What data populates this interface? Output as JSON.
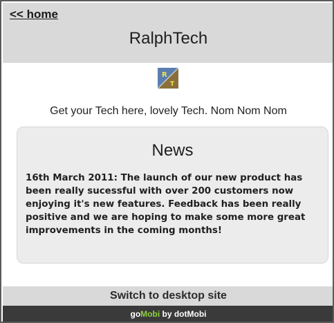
{
  "header": {
    "home_link": "<< home",
    "title": "RalphTech"
  },
  "logo": {
    "letters": [
      "R",
      "T"
    ],
    "icon": "ralphtech-logo-icon"
  },
  "tagline": "Get your Tech here, lovely Tech. Nom Nom Nom",
  "news": {
    "title": "News",
    "body": "16th March 2011: The launch of our new product has been really sucessful with over 200 customers now enjoying it's new features. Feedback has been really positive and we are hoping to make some more great improvements in the coming months!"
  },
  "switch_label": "Switch to desktop site",
  "footer": {
    "brand_prefix": "go",
    "brand_accent": "Mobi",
    "by_text": " by dot",
    "brand_suffix": "Mobi"
  },
  "colors": {
    "header_bg": "#d9d9d9",
    "news_bg": "#ececec",
    "footer_bg": "#3a3a3a",
    "footer_accent": "#8fd13f"
  }
}
